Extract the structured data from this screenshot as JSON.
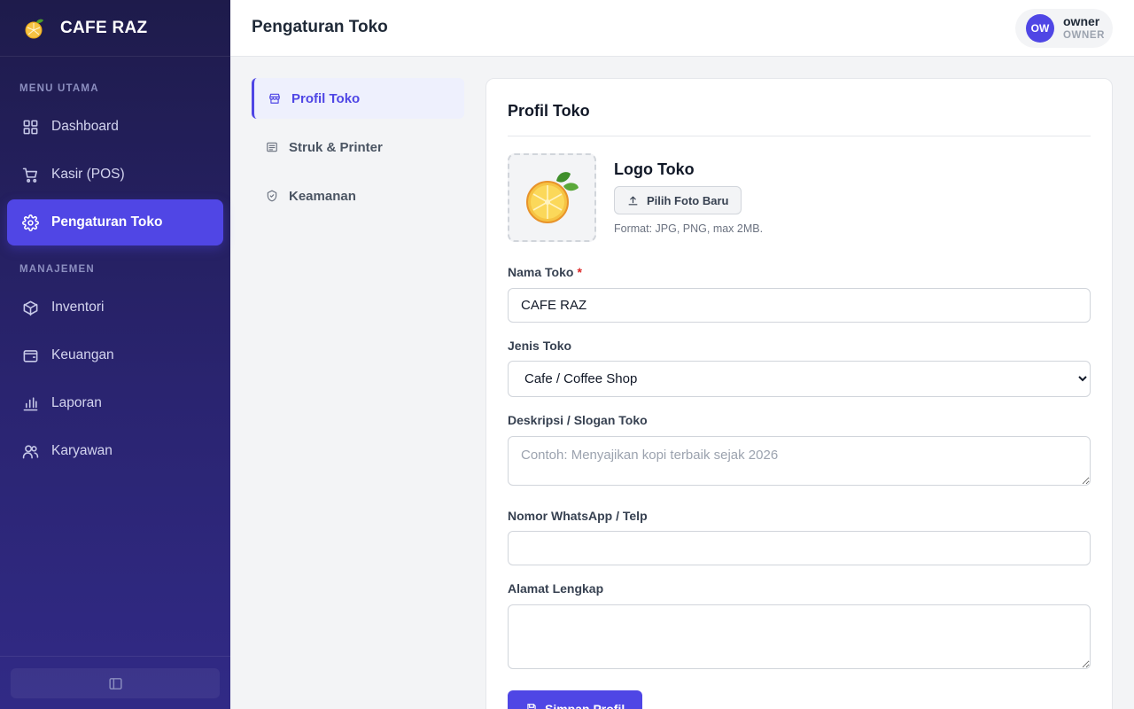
{
  "brand": {
    "name": "CAFE RAZ"
  },
  "sidebar": {
    "sections": [
      {
        "title": "MENU UTAMA"
      },
      {
        "title": "MANAJEMEN"
      }
    ],
    "items": [
      {
        "label": "Dashboard",
        "icon": "grid-icon",
        "active": false
      },
      {
        "label": "Kasir (POS)",
        "icon": "cart-icon",
        "active": false
      },
      {
        "label": "Pengaturan Toko",
        "icon": "gear-icon",
        "active": true
      },
      {
        "label": "Inventori",
        "icon": "box-icon",
        "active": false
      },
      {
        "label": "Keuangan",
        "icon": "wallet-icon",
        "active": false
      },
      {
        "label": "Laporan",
        "icon": "bar-chart-icon",
        "active": false
      },
      {
        "label": "Karyawan",
        "icon": "users-icon",
        "active": false
      }
    ],
    "collapse_icon": "sidebar-collapse-icon"
  },
  "header": {
    "title": "Pengaturan Toko",
    "user": {
      "initials": "OW",
      "name": "owner",
      "role": "OWNER"
    }
  },
  "settings_nav": [
    {
      "label": "Profil Toko",
      "icon": "store-icon",
      "active": true
    },
    {
      "label": "Struk & Printer",
      "icon": "receipt-icon",
      "active": false
    },
    {
      "label": "Keamanan",
      "icon": "shield-icon",
      "active": false
    }
  ],
  "profile_form": {
    "title": "Profil Toko",
    "logo": {
      "heading": "Logo Toko",
      "upload_label": "Pilih Foto Baru",
      "hint": "Format: JPG, PNG, max 2MB."
    },
    "store_name": {
      "label": "Nama Toko",
      "required_mark": "*",
      "value": "CAFE RAZ"
    },
    "store_type": {
      "label": "Jenis Toko",
      "selected": "Cafe / Coffee Shop"
    },
    "description": {
      "label": "Deskripsi / Slogan Toko",
      "placeholder": "Contoh: Menyajikan kopi terbaik sejak 2026",
      "value": ""
    },
    "phone": {
      "label": "Nomor WhatsApp / Telp",
      "value": ""
    },
    "address": {
      "label": "Alamat Lengkap",
      "value": ""
    },
    "save_label": "Simpan Profil"
  },
  "colors": {
    "accent": "#4f46e5",
    "sidebar_top": "#1e1b4b",
    "sidebar_bottom": "#312a86",
    "required": "#dc2626"
  }
}
